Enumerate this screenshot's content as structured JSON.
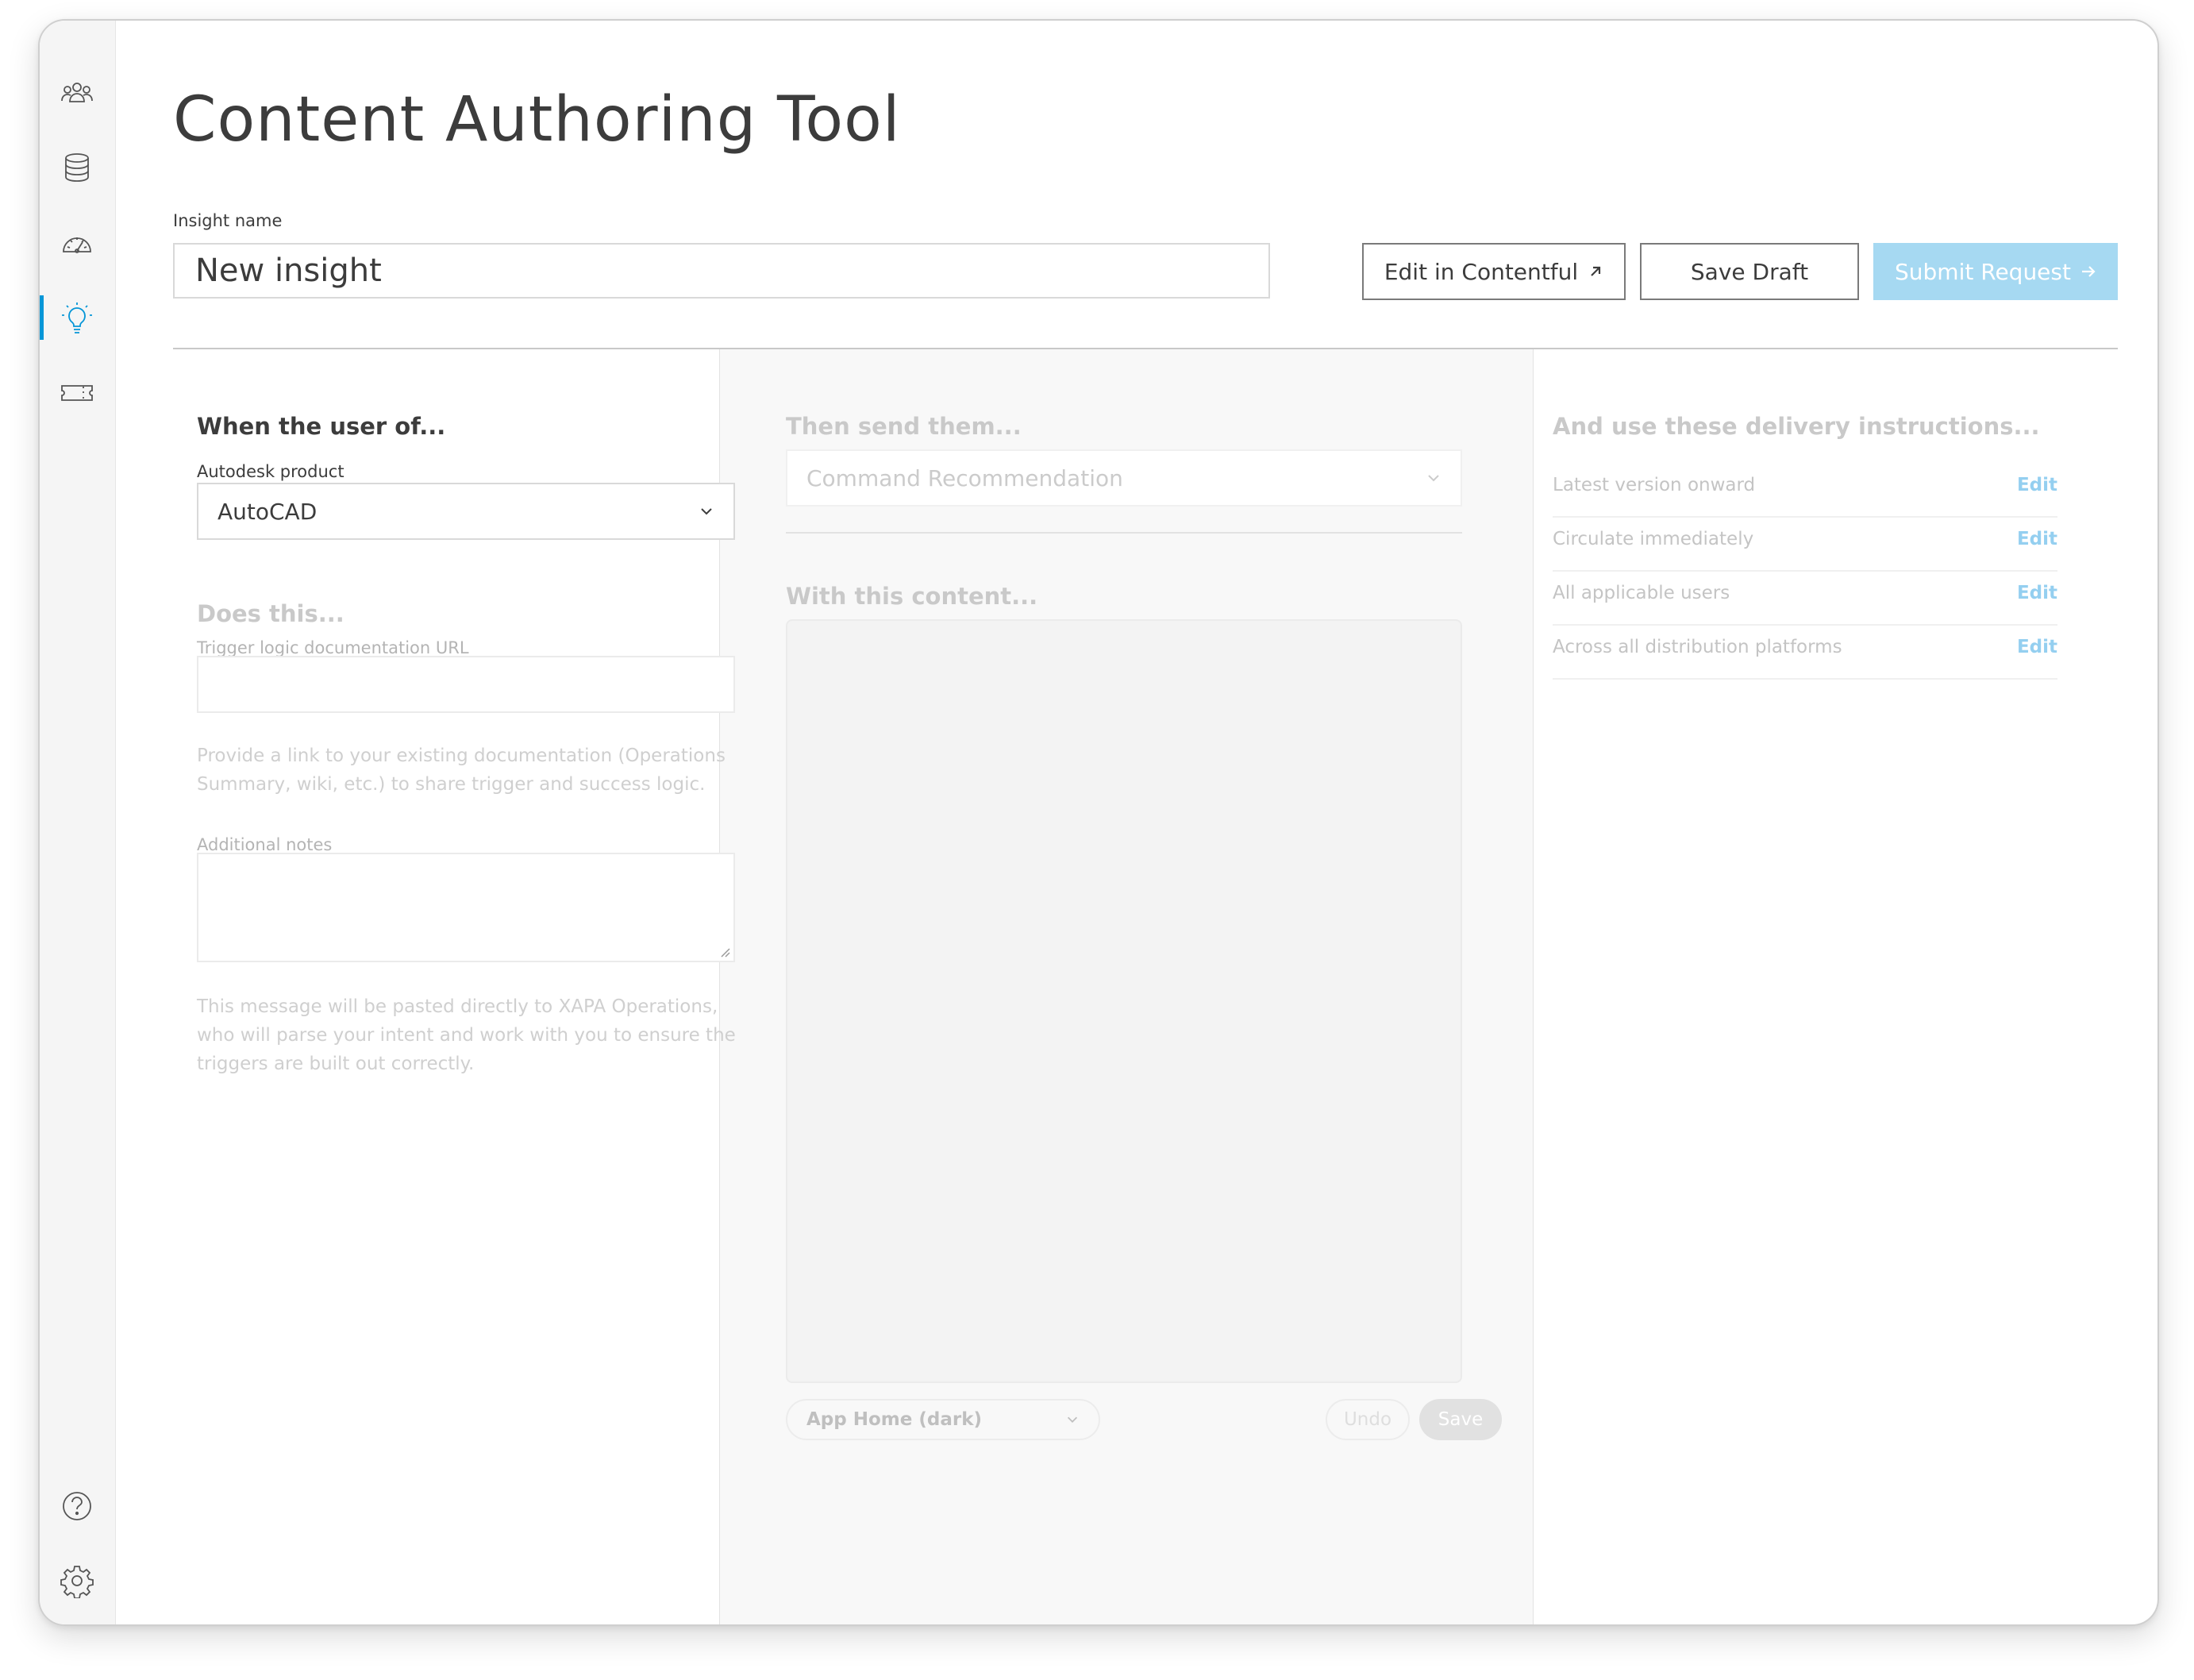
{
  "app": {
    "title": "Content Authoring Tool"
  },
  "sidebar": {
    "items": [
      {
        "icon": "users-icon"
      },
      {
        "icon": "database-icon"
      },
      {
        "icon": "dashboard-gauge-icon"
      },
      {
        "icon": "lightbulb-icon",
        "active": true
      },
      {
        "icon": "ticket-icon"
      }
    ],
    "bottom_items": [
      {
        "icon": "help-icon"
      },
      {
        "icon": "settings-gear-icon"
      }
    ],
    "accent_color": "#0696d7"
  },
  "header": {
    "insight_name_label": "Insight name",
    "insight_name_value": "New insight",
    "edit_contentful_label": "Edit in Contentful",
    "save_draft_label": "Save Draft",
    "submit_request_label": "Submit Request"
  },
  "left_column": {
    "heading": "When the user of...",
    "product_label": "Autodesk product",
    "product_value": "AutoCAD",
    "does_heading": "Does this...",
    "trigger_url_label": "Trigger logic documentation URL",
    "trigger_url_value": "",
    "trigger_help": "Provide a link to your existing documentation (Operations Summary, wiki, etc.) to share trigger and success logic.",
    "notes_label": "Additional notes",
    "notes_value": "",
    "notes_help": "This message will be pasted directly to XAPA Operations, who will parse your intent and work with you to ensure the triggers are built out correctly."
  },
  "middle_column": {
    "heading": "Then send them...",
    "type_value": "Command Recommendation",
    "content_heading": "With this content...",
    "preview_select": "App Home (dark)",
    "undo_label": "Undo",
    "save_label": "Save"
  },
  "right_column": {
    "heading": "And use these delivery instructions...",
    "rows": [
      {
        "text": "Latest version onward",
        "action": "Edit"
      },
      {
        "text": "Circulate immediately",
        "action": "Edit"
      },
      {
        "text": "All applicable users",
        "action": "Edit"
      },
      {
        "text": "Across all distribution platforms",
        "action": "Edit"
      }
    ]
  }
}
